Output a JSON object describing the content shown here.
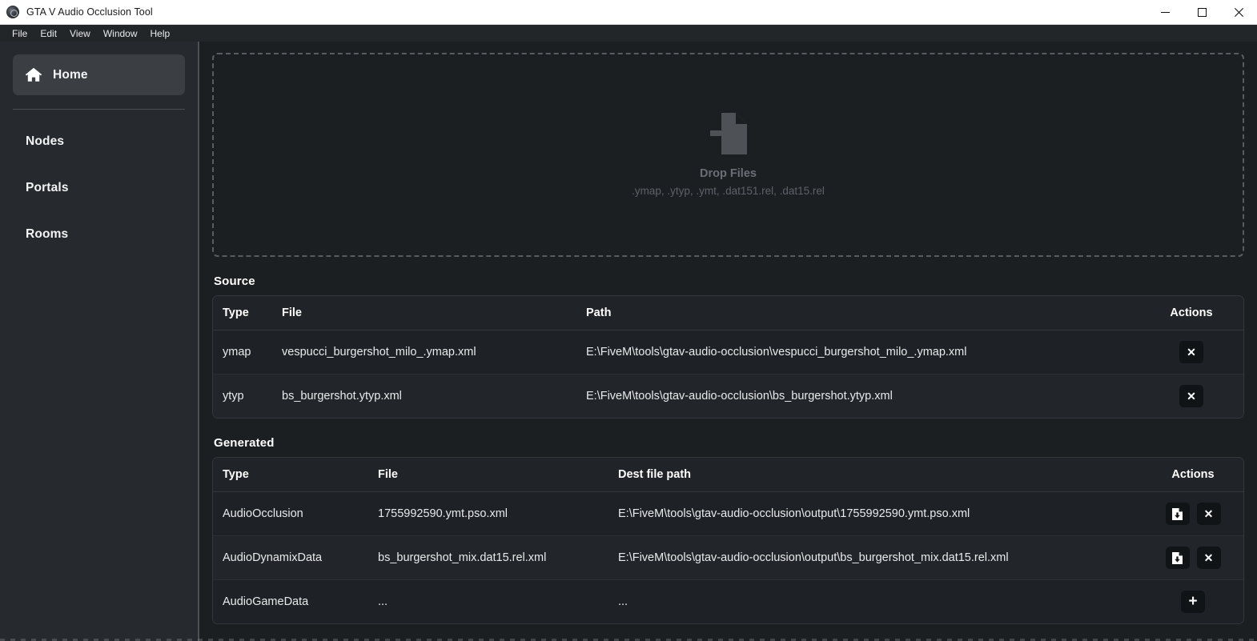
{
  "window": {
    "title": "GTA V Audio Occlusion Tool",
    "app_icon": "app-logo-icon",
    "minimize_label": "Minimize",
    "maximize_label": "Maximize",
    "close_label": "Close"
  },
  "menubar": {
    "items": [
      {
        "label": "File"
      },
      {
        "label": "Edit"
      },
      {
        "label": "View"
      },
      {
        "label": "Window"
      },
      {
        "label": "Help"
      }
    ]
  },
  "sidebar": {
    "primary": {
      "label": "Home",
      "icon": "home-icon",
      "active": true
    },
    "items": [
      {
        "label": "Nodes"
      },
      {
        "label": "Portals"
      },
      {
        "label": "Rooms"
      }
    ]
  },
  "dropzone": {
    "icon": "file-import-icon",
    "title": "Drop Files",
    "subtitle": ".ymap, .ytyp, .ymt, .dat151.rel, .dat15.rel"
  },
  "source": {
    "title": "Source",
    "columns": [
      "Type",
      "File",
      "Path",
      "Actions"
    ],
    "rows": [
      {
        "type": "ymap",
        "file": "vespucci_burgershot_milo_.ymap.xml",
        "path": "E:\\FiveM\\tools\\gtav-audio-occlusion\\vespucci_burgershot_milo_.ymap.xml",
        "actions": [
          {
            "icon": "close-x-icon",
            "label": "Remove"
          }
        ]
      },
      {
        "type": "ytyp",
        "file": "bs_burgershot.ytyp.xml",
        "path": "E:\\FiveM\\tools\\gtav-audio-occlusion\\bs_burgershot.ytyp.xml",
        "actions": [
          {
            "icon": "close-x-icon",
            "label": "Remove"
          }
        ]
      }
    ]
  },
  "generated": {
    "title": "Generated",
    "columns": [
      "Type",
      "File",
      "Dest file path",
      "Actions"
    ],
    "rows": [
      {
        "type": "AudioOcclusion",
        "file": "1755992590.ymt.pso.xml",
        "path": "E:\\FiveM\\tools\\gtav-audio-occlusion\\output\\1755992590.ymt.pso.xml",
        "actions": [
          {
            "icon": "file-download-icon",
            "label": "Save file"
          },
          {
            "icon": "close-x-icon",
            "label": "Remove"
          }
        ]
      },
      {
        "type": "AudioDynamixData",
        "file": "bs_burgershot_mix.dat15.rel.xml",
        "path": "E:\\FiveM\\tools\\gtav-audio-occlusion\\output\\bs_burgershot_mix.dat15.rel.xml",
        "actions": [
          {
            "icon": "file-download-icon",
            "label": "Save file"
          },
          {
            "icon": "close-x-icon",
            "label": "Remove"
          }
        ]
      },
      {
        "type": "AudioGameData",
        "file": "...",
        "path": "...",
        "actions": [
          {
            "icon": "plus-icon",
            "label": "Add"
          }
        ]
      }
    ]
  },
  "colors": {
    "window_background": "#1c1f22",
    "sidebar_background": "#26292d",
    "sidebar_active": "#3b3e43",
    "titlebar_background": "#ffffff",
    "menubar_background": "#232629",
    "table_border": "#34383d",
    "text_primary": "#ffffff",
    "text_muted": "#6a6f75",
    "icon_button_background": "#111417"
  }
}
